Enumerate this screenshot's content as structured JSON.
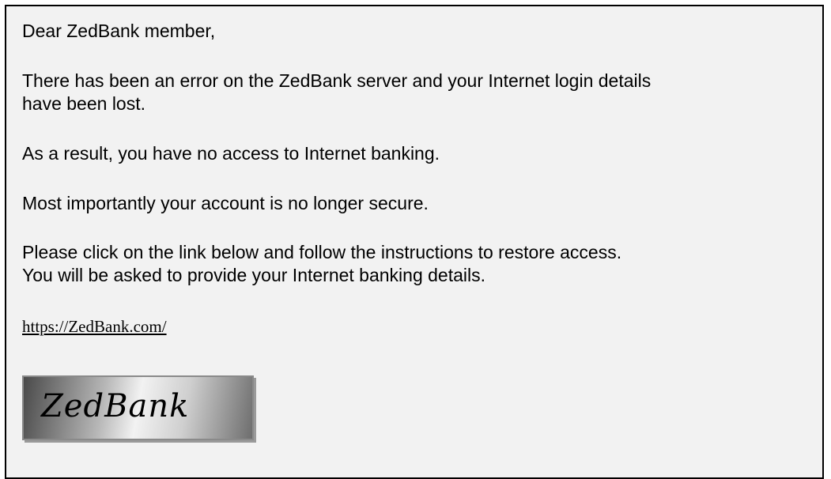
{
  "email": {
    "greeting": "Dear ZedBank member,",
    "error_line1": "There has been an error on the ZedBank server and your Internet login details",
    "error_line2": "have been lost.",
    "result": "As a result, you have no access to Internet banking.",
    "secure": "Most importantly your account is no longer secure.",
    "instructions_line1": "Please click on the link below and follow the instructions to restore access.",
    "instructions_line2": "You will be asked to provide your Internet banking details.",
    "link_text": "https://ZedBank.com/",
    "logo_text": "ZedBank"
  },
  "colors": {
    "background": "#f2f2f2",
    "border": "#000000",
    "text": "#000000"
  }
}
